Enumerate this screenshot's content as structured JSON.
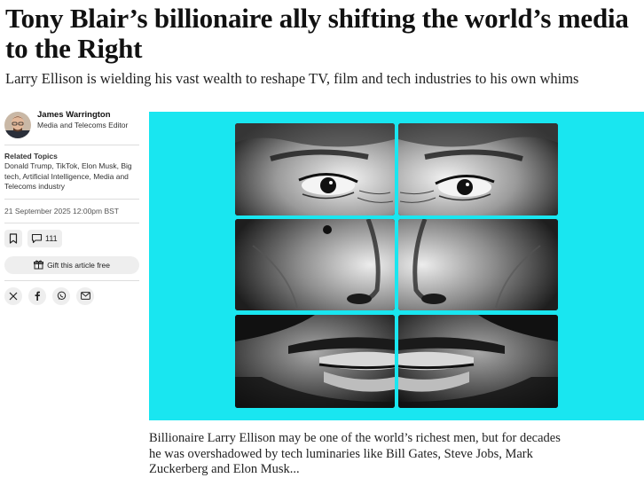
{
  "article": {
    "headline": "Tony Blair’s billionaire ally shifting the world’s media to the Right",
    "standfirst": "Larry Ellison is wielding his vast wealth to reshape TV, film and tech industries to his own whims",
    "body_excerpt": "Billionaire Larry Ellison may be one of the world’s richest men, but for decades he was overshadowed by tech luminaries like Bill Gates, Steve Jobs, Mark Zuckerberg and Elon Musk..."
  },
  "author": {
    "name": "James Warrington",
    "role": "Media and Telecoms Editor"
  },
  "topics": {
    "label": "Related Topics",
    "items": [
      "Donald Trump",
      "TikTok",
      "Elon Musk",
      "Big tech",
      "Artificial Intelligence",
      "Media and Telecoms industry"
    ]
  },
  "timestamp": "21 September 2025 12:00pm BST",
  "actions": {
    "comments_count": "111",
    "gift_label": "Gift this article free"
  },
  "icons": {
    "bookmark": "bookmark-icon",
    "comments": "speech-bubble-icon",
    "gift": "gift-icon",
    "share": [
      "x-icon",
      "facebook-icon",
      "whatsapp-icon",
      "email-icon"
    ]
  },
  "colors": {
    "hero_background": "#19e6f0",
    "button_background": "#eeeeee"
  }
}
